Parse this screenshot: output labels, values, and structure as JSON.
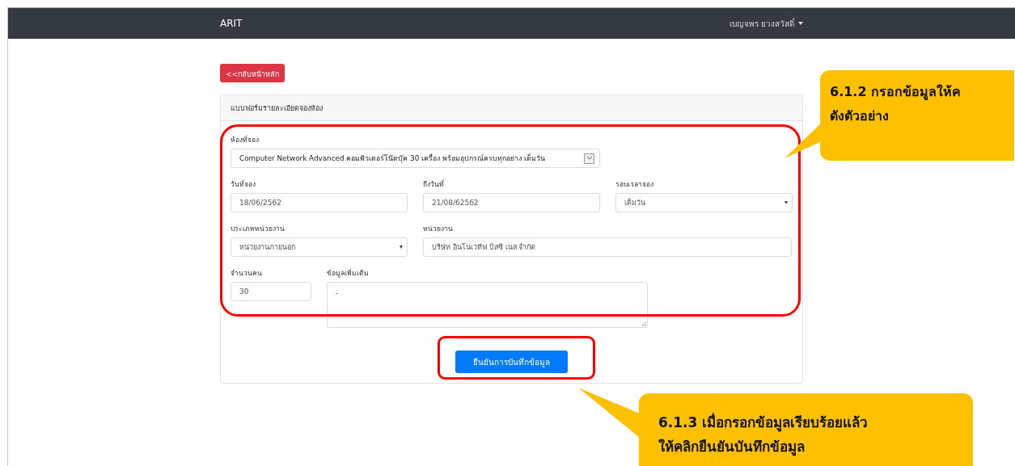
{
  "navbar": {
    "brand": "ARIT",
    "user_menu": "เบญจพร ยวงสวัสดิ์"
  },
  "back_button": "<<กลับหน้าหลัก",
  "card": {
    "title": "แบบฟอร์มรายละเอียดจองห้อง",
    "rows": [
      [
        {
          "label": "ห้องที่จอง",
          "kind": "combo",
          "value": "Computer Network Advanced คอมพิวเตอร์โน๊ตบุ๊ค 30 เครื่อง พร้อมอุปกรณ์ครบทุกอย่าง เต็มวัน"
        }
      ],
      [
        {
          "label": "วันที่จอง",
          "kind": "input",
          "value": "18/06/2562"
        },
        {
          "label": "ถึงวันที่",
          "kind": "input",
          "value": "21/08/62562"
        },
        {
          "label": "รอบเวลาจอง",
          "kind": "select",
          "value": "เต็มวัน"
        }
      ],
      [
        {
          "label": "ประเภทหน่วยงาน",
          "kind": "select",
          "value": "หน่วยงานภายนอก"
        },
        {
          "label": "หน่วยงาน",
          "kind": "input",
          "value": "บริษัท อินโนเวทีฟ บิสซิ เนส จำกัด"
        }
      ],
      [
        {
          "label": "จำนวนคน",
          "kind": "input",
          "value": "30"
        },
        {
          "label": "ข้อมูลเพิ่มเติม",
          "kind": "textarea",
          "value": "-"
        }
      ]
    ],
    "submit_button": "ยืนยันการบันทึกข้อมูล"
  },
  "callouts": [
    {
      "lines": [
        "6.1.2 กรอกข้อมูลให้ค",
        "ดังตัวอย่าง"
      ]
    },
    {
      "lines": [
        "6.1.3 เมื่อกรอกข้อมูลเรียบร้อยแล้ว",
        "ให้คลิกยืนยันบันทึกข้อมูล"
      ]
    }
  ]
}
